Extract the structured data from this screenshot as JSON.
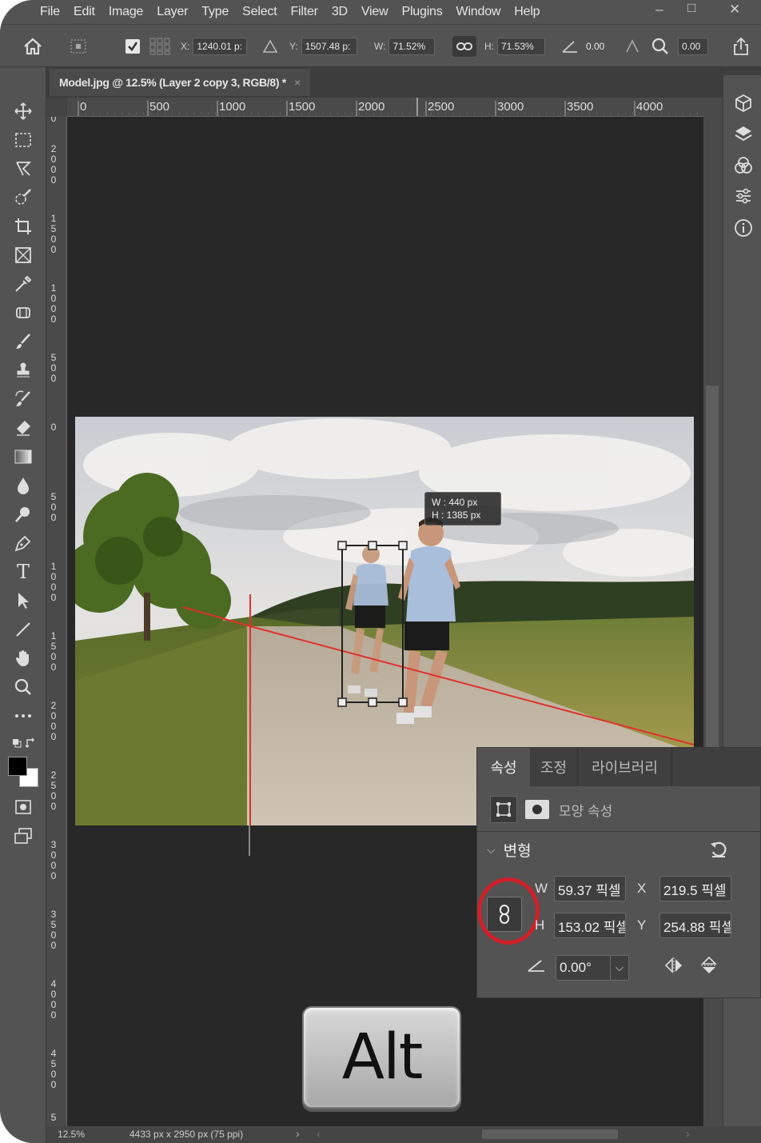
{
  "menu": [
    "File",
    "Edit",
    "Image",
    "Layer",
    "Type",
    "Select",
    "Filter",
    "3D",
    "View",
    "Plugins",
    "Window",
    "Help"
  ],
  "window_controls": {
    "minimize": "–",
    "maximize": "□",
    "close": "✕"
  },
  "options": {
    "x_label": "X:",
    "x_value": "1240.01 p:",
    "y_label": "Y:",
    "y_value": "1507.48 p:",
    "w_label": "W:",
    "w_value": "71.52%",
    "h_label": "H:",
    "h_value": "71.53%",
    "angle_value": "0.00",
    "skew_value": "0.00"
  },
  "document": {
    "tab_title": "Model.jpg @ 12.5% (Layer 2 copy 3, RGB/8) *",
    "close": "×"
  },
  "ruler_h": [
    "0",
    "500",
    "1000",
    "1500",
    "2000",
    "2500",
    "3000",
    "3500",
    "4000"
  ],
  "ruler_v": [
    "0",
    "2000",
    "1500",
    "1000",
    "500",
    "0",
    "500",
    "1000",
    "1500",
    "2000",
    "2500",
    "3000",
    "3500",
    "4000",
    "4500",
    "5"
  ],
  "transform_tooltip": {
    "w": "W :    440 px",
    "h": "H :   1385 px"
  },
  "properties": {
    "tabs": [
      "속성",
      "조정",
      "라이브러리"
    ],
    "shape_props_label": "모양 속성",
    "section": "변형",
    "w_label": "W",
    "w_value": "59.37 픽셀",
    "x_label": "X",
    "x_value": "219.5 픽셀",
    "h_label": "H",
    "h_value": "153.02 픽셀",
    "y_label": "Y",
    "y_value": "254.88 픽셀",
    "angle_value": "0.00°"
  },
  "key_overlay": "Alt",
  "status": {
    "zoom": "12.5%",
    "size": "4433 px x 2950 px (75 ppi)"
  },
  "colors": {
    "accent_red": "#d0202a",
    "guide_line": "#e0302a",
    "chrome": "#535353",
    "canvas": "#282828"
  },
  "icons": [
    "home-icon",
    "move-icon",
    "marquee-icon",
    "lasso-icon",
    "quick-select-icon",
    "crop-icon",
    "frame-icon",
    "eyedropper-icon",
    "healing-icon",
    "brush-icon",
    "stamp-icon",
    "history-brush-icon",
    "eraser-icon",
    "gradient-icon",
    "blur-icon",
    "dodge-icon",
    "pen-icon",
    "type-icon",
    "path-select-icon",
    "line-icon",
    "hand-icon",
    "zoom-icon",
    "more-icon",
    "link-icon",
    "reset-icon",
    "flip-h-icon",
    "flip-v-icon"
  ]
}
